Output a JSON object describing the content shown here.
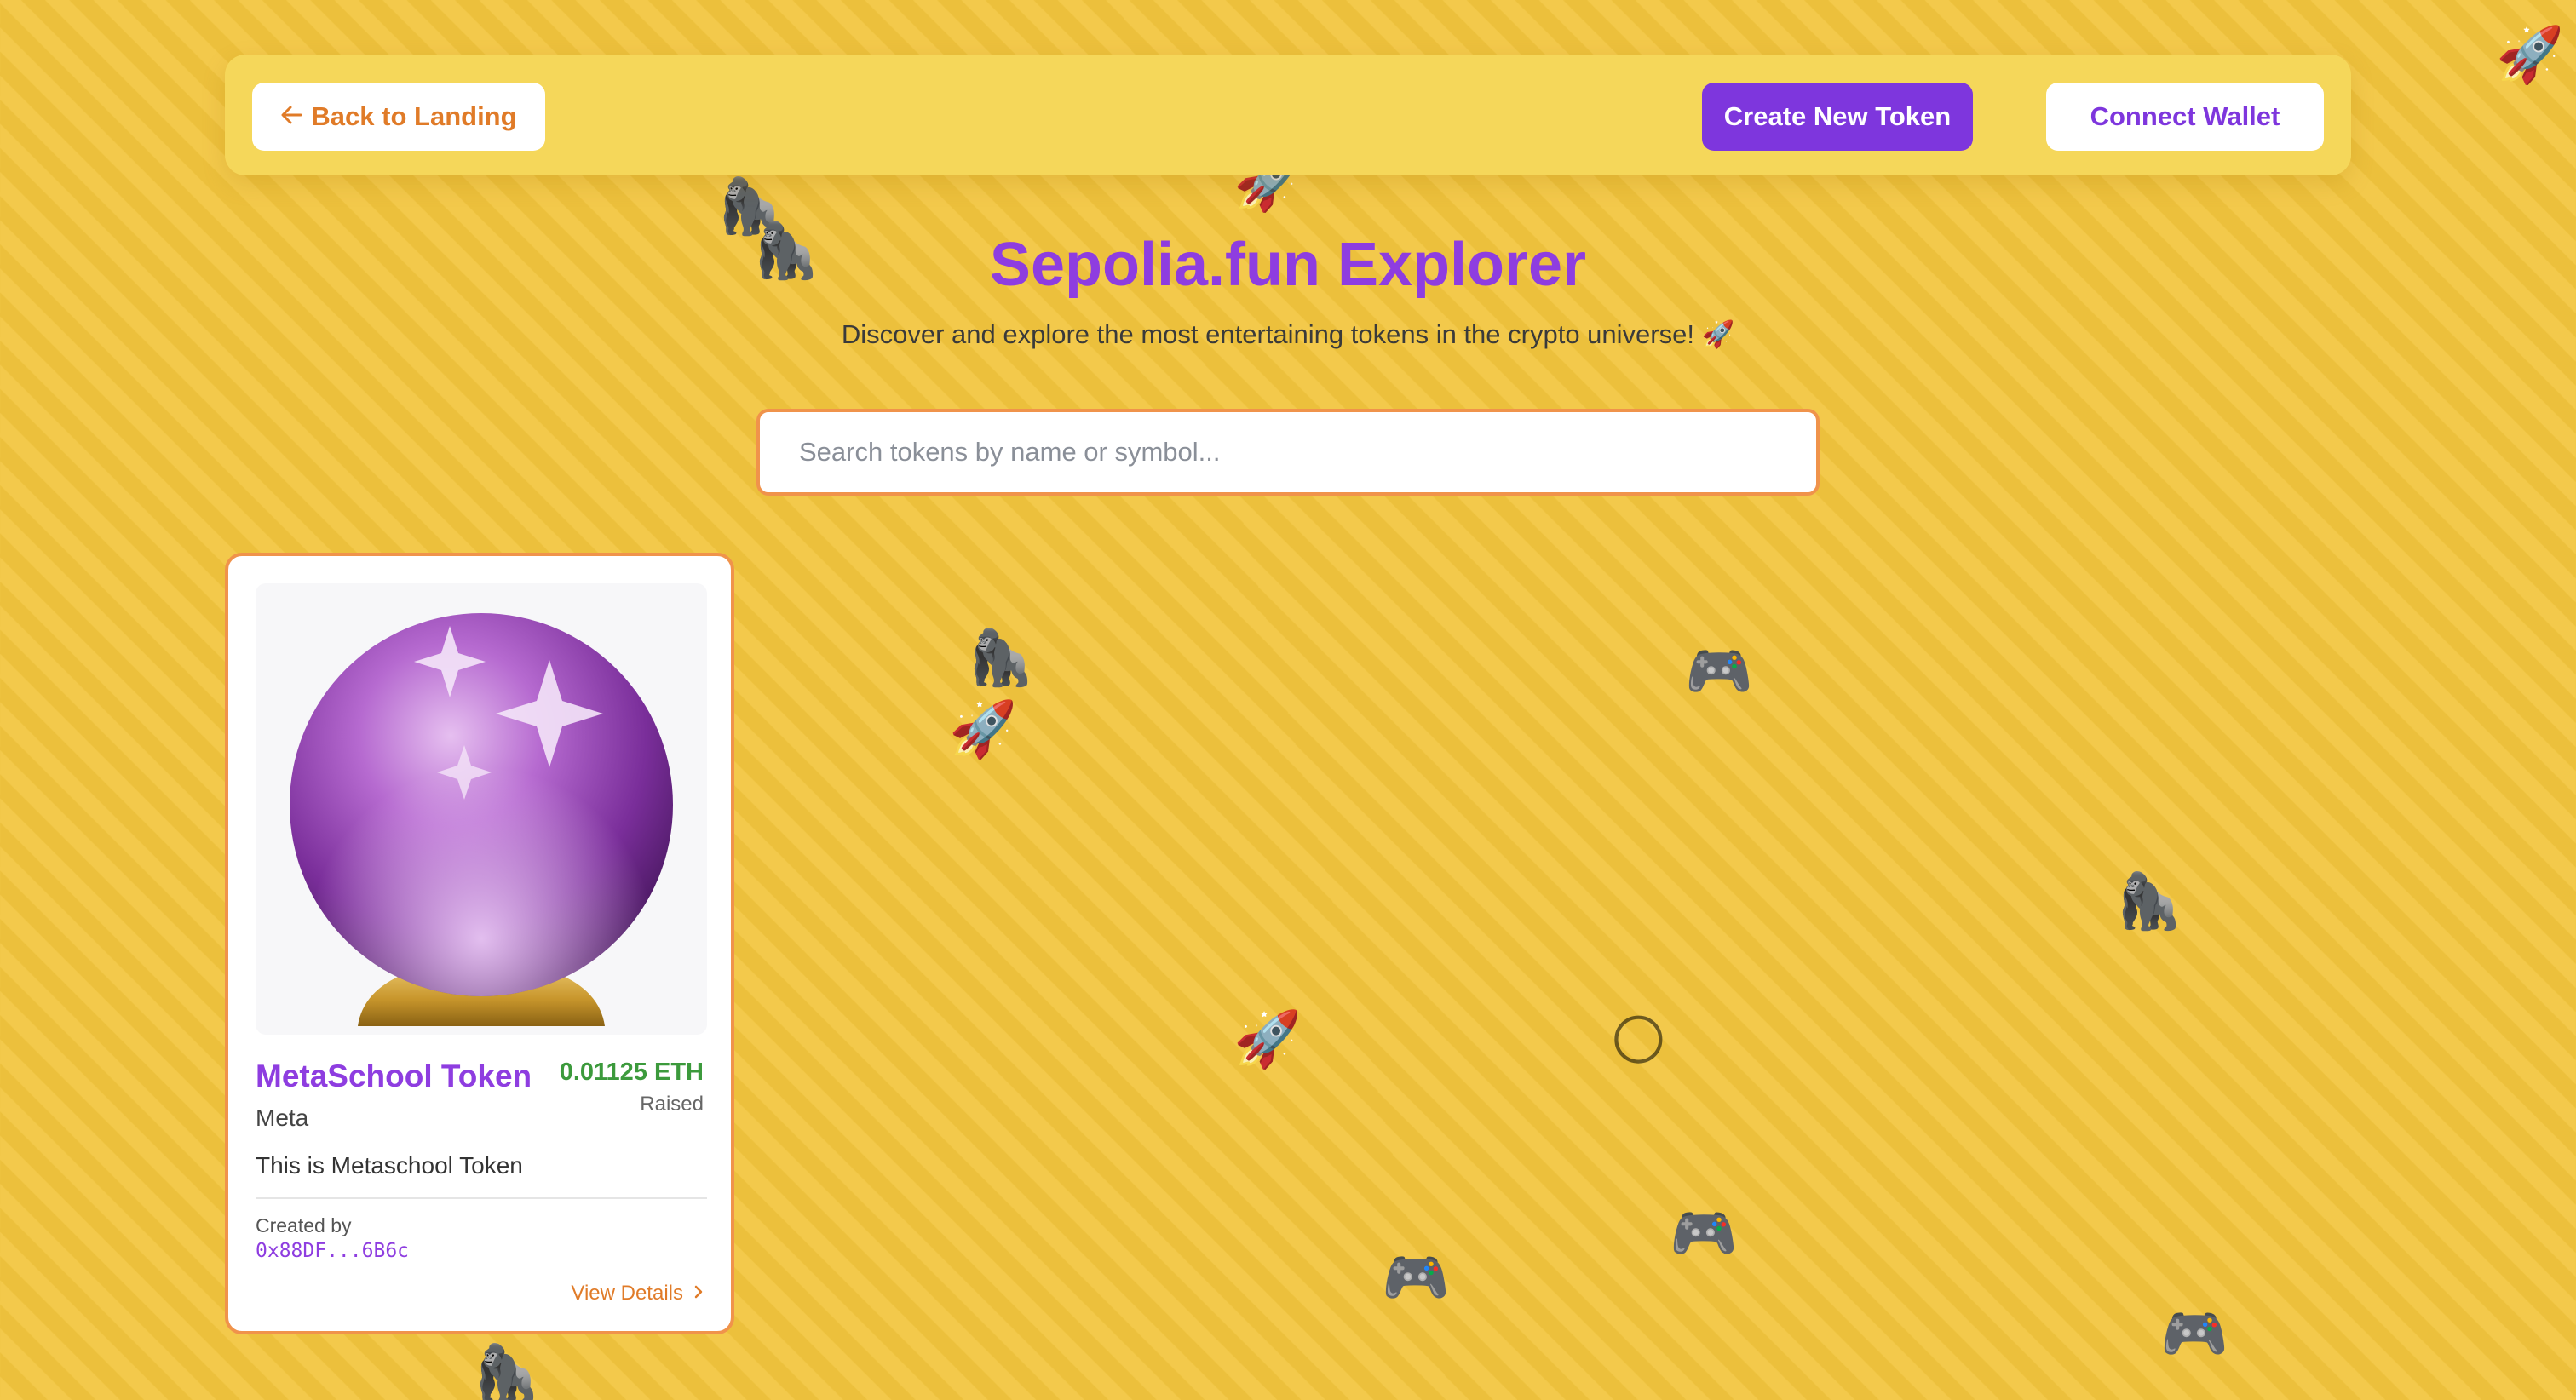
{
  "nav": {
    "back_icon": "arrow-left-icon",
    "back_label": "Back to Landing",
    "create_label": "Create New Token",
    "wallet_label": "Connect Wallet"
  },
  "header": {
    "title": "Sepolia.fun Explorer",
    "subtitle": "Discover and explore the most entertaining tokens in the crypto universe! 🚀"
  },
  "search": {
    "placeholder": "Search tokens by name or symbol...",
    "value": ""
  },
  "tokens": [
    {
      "image_icon": "crystal-ball-icon",
      "name": "MetaSchool Token",
      "symbol": "Meta",
      "raised": "0.01125 ETH",
      "raised_label": "Raised",
      "description": "This is Metaschool Token",
      "created_by_label": "Created by",
      "creator": "0x88DF...6B6c",
      "view_details_label": "View Details",
      "view_details_icon": "chevron-right-icon"
    }
  ],
  "decorations": {
    "rocket": "🚀",
    "gorilla": "🦍",
    "gamepad": "🎮",
    "moon": "🌕"
  },
  "colors": {
    "background": "#f2c53d",
    "navbar": "#f5d75a",
    "accent_purple": "#7e36dd",
    "title_purple": "#8e3de0",
    "accent_orange": "#e07b28",
    "border_orange": "#f0934b",
    "raised_green": "#3c9a3c"
  }
}
